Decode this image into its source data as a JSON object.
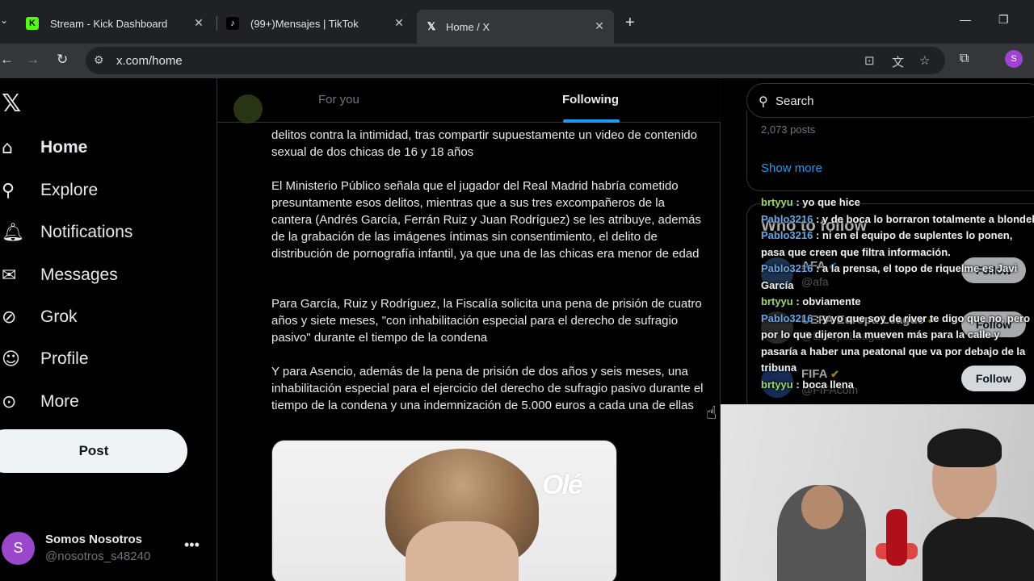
{
  "browser": {
    "tabs": [
      {
        "title": "Stream - Kick Dashboard",
        "favicon": "K",
        "favicon_color": "#53fc18"
      },
      {
        "title": "(99+)Mensajes | TikTok",
        "favicon": "♪",
        "favicon_color": "#ffffff"
      },
      {
        "title": "Home / X",
        "favicon": "𝕏",
        "favicon_color": "#ffffff"
      }
    ],
    "url": "x.com/home",
    "profile_initial": "S"
  },
  "x": {
    "nav": [
      {
        "label": "Home",
        "icon": "home-icon"
      },
      {
        "label": "Explore",
        "icon": "search-icon"
      },
      {
        "label": "Notifications",
        "icon": "bell-icon"
      },
      {
        "label": "Messages",
        "icon": "mail-icon"
      },
      {
        "label": "Grok",
        "icon": "grok-icon"
      },
      {
        "label": "Profile",
        "icon": "person-icon"
      },
      {
        "label": "More",
        "icon": "more-circle-icon"
      }
    ],
    "post_button": "Post",
    "account": {
      "initial": "S",
      "name": "Somos Nosotros",
      "handle": "@nosotros_s48240"
    },
    "feed_tabs": {
      "for_you": "For you",
      "following": "Following"
    },
    "post": {
      "p1": "delitos contra la intimidad, tras compartir supuestamente un video de contenido sexual de dos chicas de 16 y 18 años",
      "p2": "El Ministerio Público señala que el jugador del Real Madrid habría cometido presuntamente esos delitos, mientras que a sus tres excompañeros de la cantera (Andrés García, Ferrán Ruiz y Juan Rodríguez) se les atribuye, además de la grabación de las imágenes íntimas sin consentimiento, el delito de distribución de pornografía infantil, ya que una de las chicas era menor de edad",
      "p3": "Para García, Ruiz y Rodríguez, la Fiscalía solicita una pena de prisión de cuatro años y siete meses, \"con inhabilitación especial para el derecho de sufragio pasivo\" durante el tiempo de la condena",
      "p4": "Y para Asencio, además de la pena de prisión de dos años y seis meses, una inhabilitación especial para el ejercicio del derecho de sufragio pasivo durante el tiempo de la condena y una indemnización de 5.000 euros a cada una de ellas",
      "media_brand": "Olé"
    },
    "search_placeholder": "Search",
    "trend": {
      "count": "2,073 posts",
      "show_more": "Show more"
    },
    "who_to_follow": {
      "title": "Who to follow",
      "accounts": [
        {
          "name": "AFA",
          "handle": "@afa",
          "button": "Follow"
        },
        {
          "name": "UEFA Europa League",
          "handle": "@EuropaLeague",
          "button": "Follow"
        },
        {
          "name": "FIFA",
          "handle": "@FIFAcom",
          "button": "Follow"
        }
      ]
    }
  },
  "chat": [
    {
      "user": "brtyyu",
      "message": "yo que hice"
    },
    {
      "user": "Pablo3216",
      "message": "y de boca lo borraron totalmente a blondel"
    },
    {
      "user": "Pablo3216",
      "message": "ni en el equipo de suplentes lo ponen, pasa que creen que filtra información."
    },
    {
      "user": "Pablo3216",
      "message": "a la prensa, el topo de riquelme es Javi García"
    },
    {
      "user": "brtyyu",
      "message": "obviamente"
    },
    {
      "user": "Pablo3216",
      "message": "y yo que soy de river te digo que no, pero por lo que dijeron la mueven más para la calle y pasaría a haber una peatonal que va por debajo de la tribuna"
    },
    {
      "user": "brtyyu",
      "message": "boca llena"
    }
  ],
  "colors": {
    "accent": "#1d9bf0",
    "background": "#000000",
    "chat_user_a": "#9ed86b",
    "chat_user_b": "#6aa7e8"
  }
}
